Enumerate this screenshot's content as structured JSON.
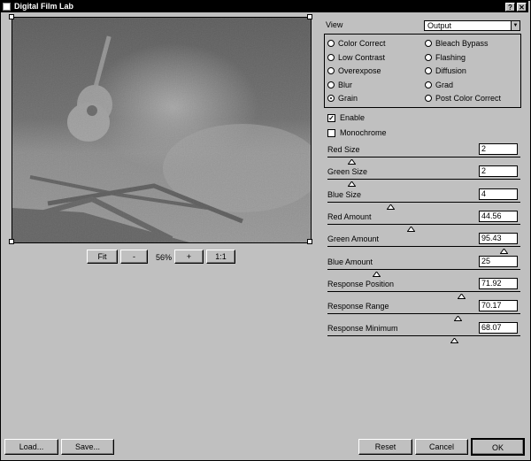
{
  "window": {
    "title": "Digital Film Lab",
    "help_label": "?",
    "close_label": "✕"
  },
  "preview": {
    "fit_label": "Fit",
    "minus_label": "-",
    "zoom": "56%",
    "plus_label": "+",
    "one_to_one_label": "1:1"
  },
  "view": {
    "label": "View",
    "selected": "Output"
  },
  "effects": [
    {
      "label": "Color Correct",
      "selected": false
    },
    {
      "label": "Bleach Bypass",
      "selected": false
    },
    {
      "label": "Low Contrast",
      "selected": false
    },
    {
      "label": "Flashing",
      "selected": false
    },
    {
      "label": "Overexpose",
      "selected": false
    },
    {
      "label": "Diffusion",
      "selected": false
    },
    {
      "label": "Blur",
      "selected": false
    },
    {
      "label": "Grad",
      "selected": false
    },
    {
      "label": "Grain",
      "selected": true
    },
    {
      "label": "Post Color Correct",
      "selected": false
    }
  ],
  "enable": {
    "label": "Enable",
    "checked": true
  },
  "monochrome": {
    "label": "Monochrome",
    "checked": false
  },
  "params": [
    {
      "label": "Red Size",
      "value": "2",
      "level": 0.12
    },
    {
      "label": "Green Size",
      "value": "2",
      "level": 0.12
    },
    {
      "label": "Blue Size",
      "value": "4",
      "level": 0.33
    },
    {
      "label": "Red Amount",
      "value": "44.56",
      "level": 0.44
    },
    {
      "label": "Green Amount",
      "value": "95.43",
      "level": 0.94
    },
    {
      "label": "Blue Amount",
      "value": "25",
      "level": 0.25
    },
    {
      "label": "Response Position",
      "value": "71.92",
      "level": 0.71
    },
    {
      "label": "Response Range",
      "value": "70.17",
      "level": 0.69
    },
    {
      "label": "Response Minimum",
      "value": "68.07",
      "level": 0.67
    }
  ],
  "footer": {
    "load_label": "Load...",
    "save_label": "Save...",
    "reset_label": "Reset",
    "cancel_label": "Cancel",
    "ok_label": "OK"
  }
}
